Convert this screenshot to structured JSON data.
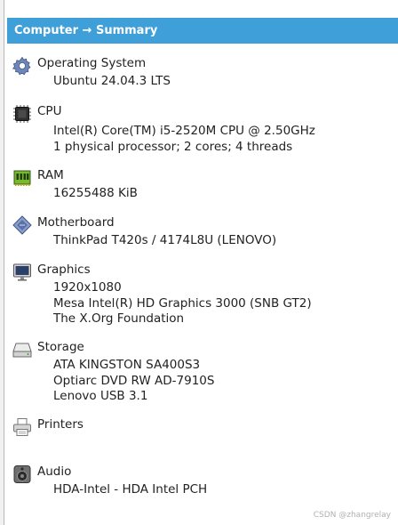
{
  "header": {
    "title": "Computer → Summary"
  },
  "sections": [
    {
      "title": "Operating System",
      "icon": "gear-icon",
      "lines": [
        "Ubuntu 24.04.3 LTS"
      ]
    },
    {
      "title": "CPU",
      "icon": "cpu-chip-icon",
      "lines": [
        "Intel(R) Core(TM) i5-2520M CPU @ 2.50GHz",
        "1 physical processor; 2 cores; 4 threads"
      ]
    },
    {
      "title": "RAM",
      "icon": "ram-module-icon",
      "lines": [
        "16255488 KiB"
      ]
    },
    {
      "title": "Motherboard",
      "icon": "motherboard-icon",
      "lines": [
        "ThinkPad T420s / 4174L8U (LENOVO)"
      ]
    },
    {
      "title": "Graphics",
      "icon": "monitor-icon",
      "lines": [
        "1920x1080",
        "Mesa Intel(R) HD Graphics 3000 (SNB GT2)",
        "The X.Org Foundation"
      ]
    },
    {
      "title": "Storage",
      "icon": "hard-drive-icon",
      "lines": [
        "ATA KINGSTON SA400S3",
        "Optiarc DVD RW AD-7910S",
        "Lenovo USB 3.1"
      ]
    },
    {
      "title": "Printers",
      "icon": "printer-icon",
      "lines": []
    },
    {
      "title": "Audio",
      "icon": "speaker-icon",
      "lines": [
        "HDA-Intel - HDA Intel PCH"
      ]
    }
  ],
  "watermark": "CSDN @zhangrelay"
}
